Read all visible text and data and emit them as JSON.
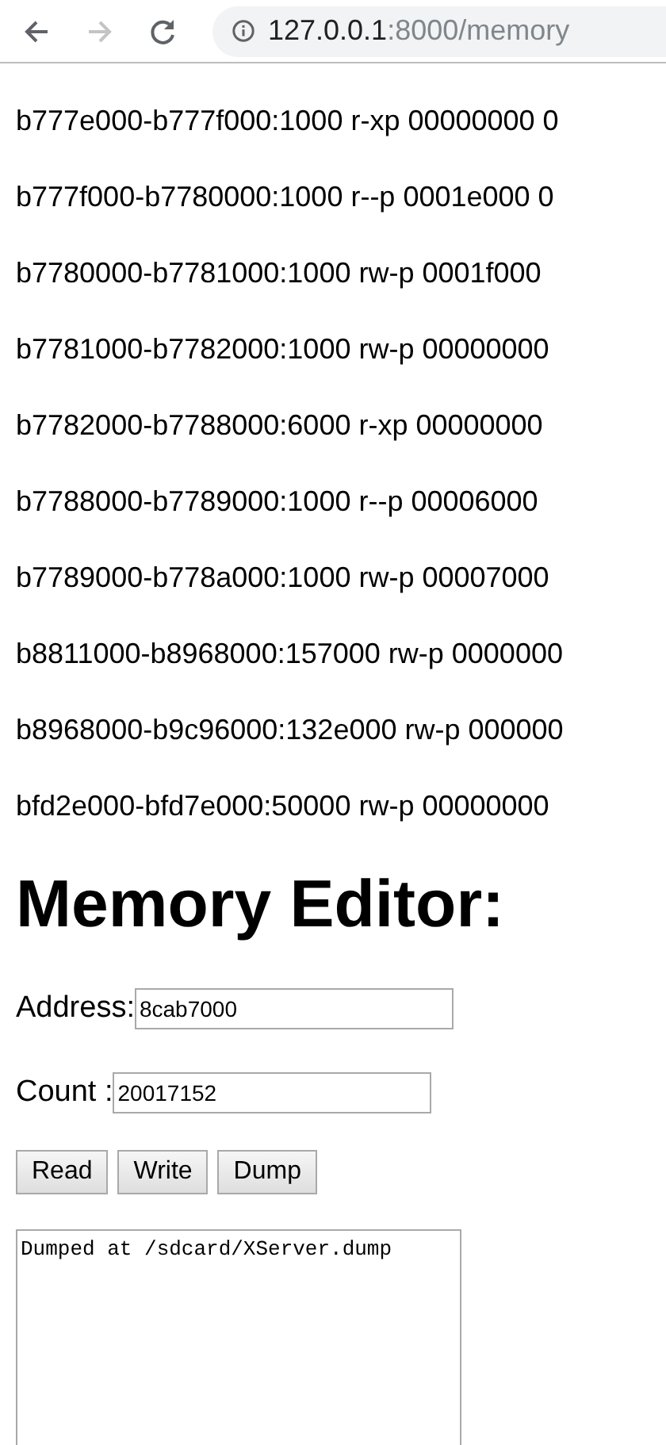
{
  "browser": {
    "url_host": "127.0.0.1",
    "url_rest": ":8000/memory"
  },
  "memory_maps": [
    "b777e000-b777f000:1000 r-xp 00000000 0",
    "b777f000-b7780000:1000 r--p 0001e000 0",
    "b7780000-b7781000:1000 rw-p 0001f000",
    "b7781000-b7782000:1000 rw-p 00000000",
    "b7782000-b7788000:6000 r-xp 00000000",
    "b7788000-b7789000:1000 r--p 00006000",
    "b7789000-b778a000:1000 rw-p 00007000",
    "b8811000-b8968000:157000 rw-p 0000000",
    "b8968000-b9c96000:132e000 rw-p 000000",
    "bfd2e000-bfd7e000:50000 rw-p 00000000"
  ],
  "editor": {
    "heading": "Memory Editor:",
    "fields": [
      {
        "label": "Address:",
        "value": "8cab7000"
      },
      {
        "label": "Count :",
        "value": "20017152"
      }
    ],
    "buttons": [
      "Read",
      "Write",
      "Dump"
    ],
    "output": "Dumped at /sdcard/XServer.dump"
  }
}
